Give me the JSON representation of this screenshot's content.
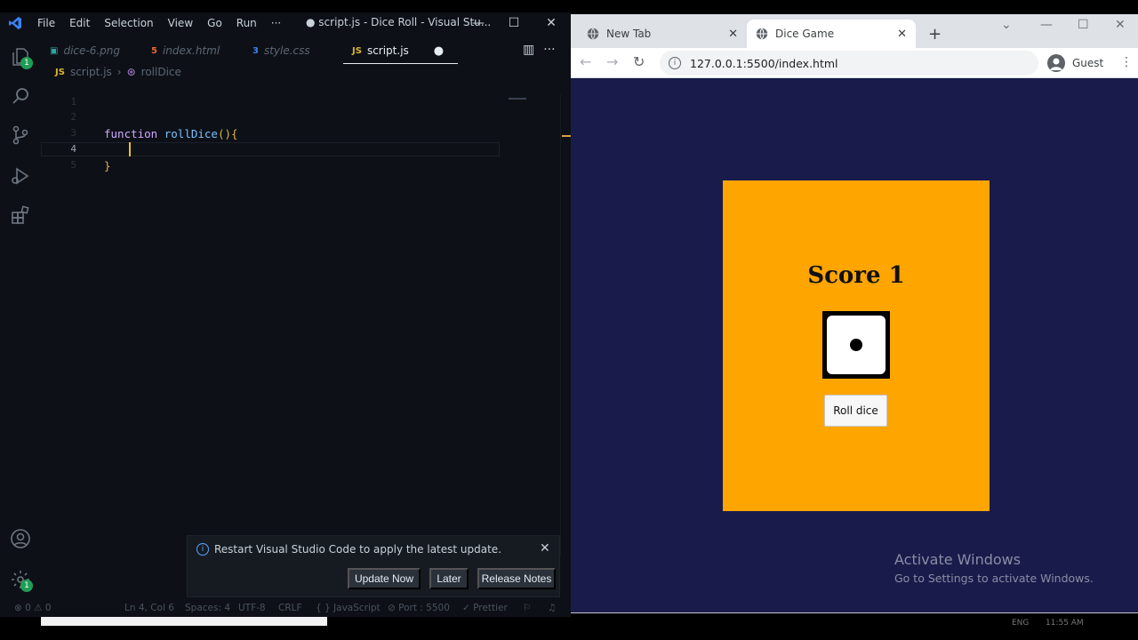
{
  "vscode": {
    "menu": [
      "File",
      "Edit",
      "Selection",
      "View",
      "Go",
      "Run",
      "···"
    ],
    "window_title": "● script.js - Dice Roll - Visual Stu...",
    "tabs": [
      {
        "label": "dice-6.png",
        "icon": "image-icon"
      },
      {
        "label": "index.html",
        "icon": "html-icon"
      },
      {
        "label": "style.css",
        "icon": "css-icon"
      },
      {
        "label": "script.js",
        "icon": "js-icon",
        "active": true,
        "modified": true
      }
    ],
    "breadcrumb": {
      "file": "script.js",
      "symbol": "rollDice"
    },
    "activity_badges": {
      "explorer": "1",
      "settings": "1"
    },
    "code": {
      "line_numbers": [
        "1",
        "2",
        "3",
        "4",
        "5"
      ],
      "keyword": "function",
      "function_name": "rollDice",
      "open": "(){",
      "close": "}"
    },
    "notification": {
      "message": "Restart Visual Studio Code to apply the latest update.",
      "buttons": [
        "Update Now",
        "Later",
        "Release Notes"
      ]
    },
    "status": {
      "problems": "⊗ 0 ⚠ 0",
      "position": "Ln 4, Col 6",
      "spaces": "Spaces: 4",
      "encoding": "UTF-8",
      "eol": "CRLF",
      "language": "{ } JavaScript",
      "port": "⊘ Port : 5500",
      "prettier": "✓ Prettier"
    },
    "colors": {
      "keyword": "#d2a8ff",
      "function": "#79c0ff",
      "bracket": "#e3b341",
      "accent": "#3b82f6"
    }
  },
  "browser": {
    "tabs": [
      {
        "label": "New Tab",
        "icon": "globe-icon"
      },
      {
        "label": "Dice Game",
        "icon": "globe-icon",
        "active": true
      }
    ],
    "url": "127.0.0.1:5500/index.html",
    "profile": "Guest",
    "page": {
      "score_label": "Score 1",
      "dice_value": 1,
      "button_label": "Roll dice",
      "colors": {
        "background": "#191c4a",
        "card": "#ffa500"
      }
    },
    "watermark": {
      "title": "Activate Windows",
      "subtitle": "Go to Settings to activate Windows."
    }
  },
  "taskbar": {
    "lang": "ENG",
    "time": "11:55 AM"
  }
}
